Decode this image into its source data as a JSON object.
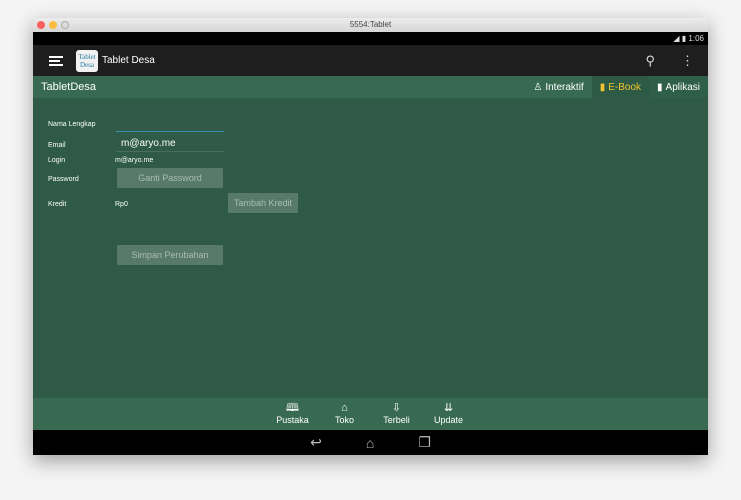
{
  "window": {
    "title": "5554:Tablet"
  },
  "status": {
    "time": "1:06"
  },
  "actionbar": {
    "logo_text": "Tablet Desa",
    "title": "Tablet Desa"
  },
  "tabbar": {
    "brand": "TabletDesa",
    "tabs": [
      {
        "label": "Interaktif"
      },
      {
        "label": "E-Book"
      },
      {
        "label": "Aplikasi"
      }
    ]
  },
  "form": {
    "nama_label": "Nama Lengkap",
    "nama_value": "",
    "email_label": "Email",
    "email_value": "m@aryo.me",
    "login_label": "Login",
    "login_value": "m@aryo.me",
    "password_label": "Password",
    "password_button": "Ganti Password",
    "kredit_label": "Kredit",
    "kredit_value": "Rp0",
    "kredit_button": "Tambah Kredit",
    "save_button": "Simpan Perubahan"
  },
  "bottomnav": [
    {
      "label": "Pustaka"
    },
    {
      "label": "Toko"
    },
    {
      "label": "Terbeli"
    },
    {
      "label": "Update"
    }
  ],
  "colors": {
    "content": "#2e5a47",
    "tabbar": "#386a52",
    "accent": "#f2c230"
  }
}
